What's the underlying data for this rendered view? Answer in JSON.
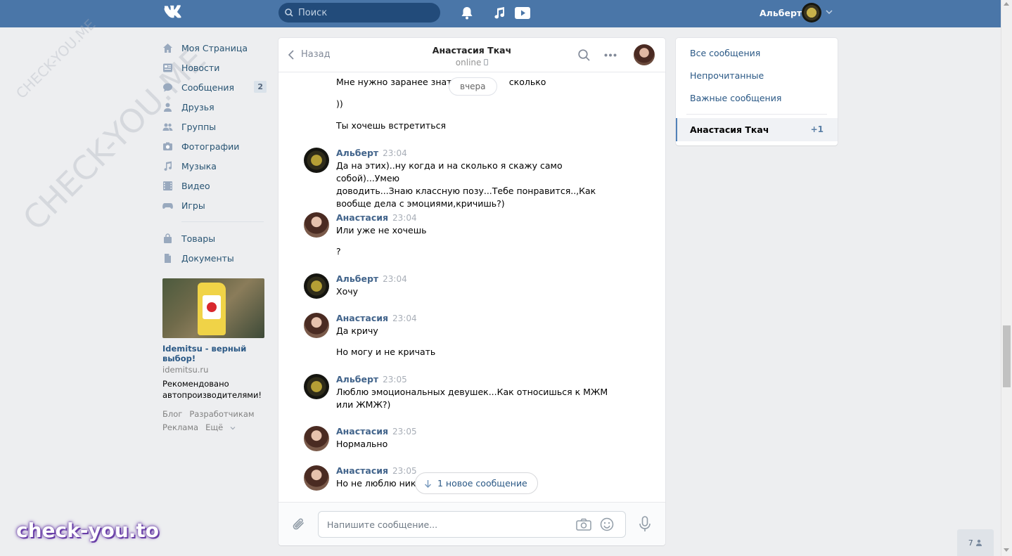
{
  "header": {
    "search_placeholder": "Поиск",
    "user_name": "Альберт"
  },
  "nav": {
    "items": [
      {
        "label": "Моя Страница",
        "icon": "home-icon"
      },
      {
        "label": "Новости",
        "icon": "news-icon"
      },
      {
        "label": "Сообщения",
        "icon": "messages-icon",
        "badge": "2"
      },
      {
        "label": "Друзья",
        "icon": "friends-icon"
      },
      {
        "label": "Группы",
        "icon": "groups-icon"
      },
      {
        "label": "Фотографии",
        "icon": "photos-icon"
      },
      {
        "label": "Музыка",
        "icon": "music-icon"
      },
      {
        "label": "Видео",
        "icon": "video-icon"
      },
      {
        "label": "Игры",
        "icon": "games-icon"
      }
    ],
    "items2": [
      {
        "label": "Товары",
        "icon": "market-icon"
      },
      {
        "label": "Документы",
        "icon": "documents-icon"
      }
    ]
  },
  "ad": {
    "title": "Idemitsu - верный выбор!",
    "domain": "idemitsu.ru",
    "text": "Рекомендовано автопроизводителями!"
  },
  "footer_links": {
    "blog": "Блог",
    "dev": "Разработчикам",
    "ads": "Реклама",
    "more": "Ещё"
  },
  "chat": {
    "back_label": "Назад",
    "peer_name": "Анастасия Ткач",
    "peer_status": "online",
    "date_pill": "вчера",
    "new_messages": "1 новое сообщение",
    "composer_placeholder": "Напишите сообщение...",
    "messages": [
      {
        "author": "",
        "time": "",
        "lines": [
          "Мне нужно заранее знать ",
          "сколько"
        ]
      },
      {
        "author": "",
        "time": "",
        "lines": [
          "))"
        ]
      },
      {
        "author": "",
        "time": "",
        "lines": [
          "Ты хочешь встретиться"
        ]
      },
      {
        "author": "Альберт",
        "time": "23:04",
        "lines": [
          "Да на этих)..ну когда и на сколько я скажу само собой)...Умею",
          "доводить...Знаю классную позу...Тебе понравится..,Как",
          "вообще дела с эмоциями,кричишь?)"
        ]
      },
      {
        "author": "Анастасия",
        "time": "23:04",
        "lines": [
          "Или уже не хочешь"
        ]
      },
      {
        "author": "",
        "time": "",
        "lines": [
          "?"
        ]
      },
      {
        "author": "Альберт",
        "time": "23:04",
        "lines": [
          "Хочу"
        ]
      },
      {
        "author": "Анастасия",
        "time": "23:04",
        "lines": [
          "Да кричу"
        ]
      },
      {
        "author": "",
        "time": "",
        "lines": [
          "Но могу и не кричать"
        ]
      },
      {
        "author": "Альберт",
        "time": "23:05",
        "lines": [
          "Люблю эмоциональных девушек...Как относишься к МЖМ",
          "или ЖМЖ?)"
        ]
      },
      {
        "author": "Анастасия",
        "time": "23:05",
        "lines": [
          "Нормально"
        ]
      },
      {
        "author": "Анастасия",
        "time": "23:05",
        "lines": [
          "Но не люблю никс"
        ]
      }
    ]
  },
  "right_panel": {
    "all": "Все сообщения",
    "unread": "Непрочитанные",
    "important": "Важные сообщения",
    "conv_name": "Анастасия Ткач",
    "conv_count": "+1"
  },
  "online_count": "7",
  "watermarks": {
    "big": "CHECK-YOU.ME",
    "small": "CHECK-YOU.ME",
    "bottom": "check-you.to"
  },
  "colors": {
    "header": "#4a76a8",
    "link": "#2a5885",
    "background": "#edeef0"
  }
}
